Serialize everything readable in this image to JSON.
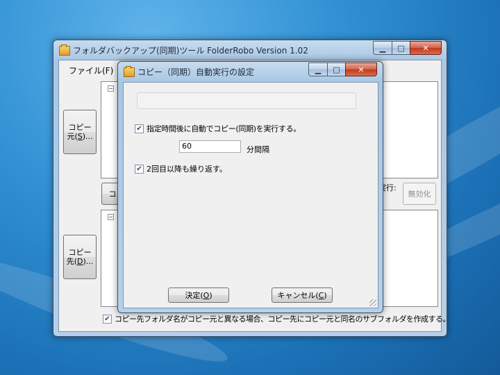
{
  "main_window": {
    "title": "フォルダバックアップ(同期)ツール FolderRobo Version 1.02",
    "menu": {
      "file": "ファイル(F)"
    },
    "source_button": {
      "line1": "コピー",
      "line2a": "元(",
      "key": "S",
      "line2b": ")..."
    },
    "dest_button": {
      "line1": "コピー",
      "line2a": "先(",
      "key": "D",
      "line2b": ")..."
    },
    "middle_button_partial": "コ",
    "exec_label_partial": "実行:",
    "disable_button": "無効化",
    "create_subfolder_checked": true,
    "create_subfolder_label": "コピー先フォルダ名がコピー元と異なる場合、コピー先にコピー元と同名のサブフォルダを作成する。"
  },
  "dialog": {
    "title": "コピー（同期）自動実行の設定",
    "auto_checkbox_checked": true,
    "auto_checkbox_label": "指定時間後に自動でコピー(同期)を実行する。",
    "interval_value": "60",
    "interval_unit": "分間隔",
    "repeat_checkbox_checked": true,
    "repeat_checkbox_label": "2回目以降も繰り返す。",
    "ok_button": {
      "pre": "決定(",
      "key": "O",
      "post": ")"
    },
    "cancel_button": {
      "pre": "キャンセル(",
      "key": "C",
      "post": ")"
    }
  },
  "caption": {
    "minimize": "▁",
    "maximize": "□",
    "close": "✕"
  },
  "colors": {
    "desktop": "#1f7fc2",
    "close_button": "#c1391d",
    "check": "#2a4b8d"
  }
}
